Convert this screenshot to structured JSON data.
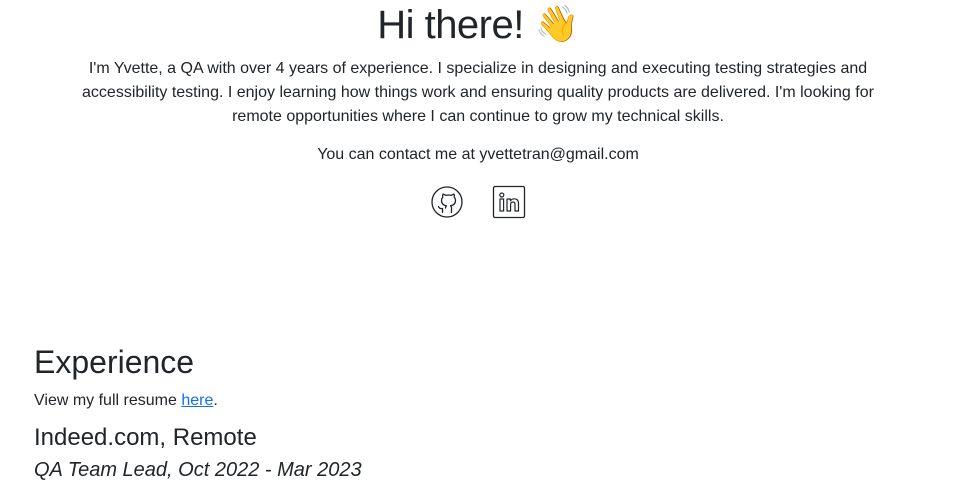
{
  "intro": {
    "greeting": "Hi there!",
    "wave_emoji": "👋",
    "bio": "I'm Yvette, a QA with over 4 years of experience. I specialize in designing and executing testing strategies and accessibility testing. I enjoy learning how things work and ensuring quality products are delivered. I'm looking for remote opportunities where I can continue to grow my technical skills.",
    "contact_text": "You can contact me at yvettetran@gmail.com"
  },
  "social": {
    "icons": [
      "github-icon",
      "linkedin-icon"
    ]
  },
  "experience": {
    "heading": "Experience",
    "resume_prefix": "View my full resume ",
    "resume_link": "here",
    "resume_suffix": ".",
    "job": {
      "company": "Indeed.com, Remote",
      "role": "QA Team Lead, Oct 2022 - Mar 2023"
    }
  },
  "colors": {
    "text": "#212529",
    "link": "#0d6efd",
    "background": "#ffffff"
  }
}
